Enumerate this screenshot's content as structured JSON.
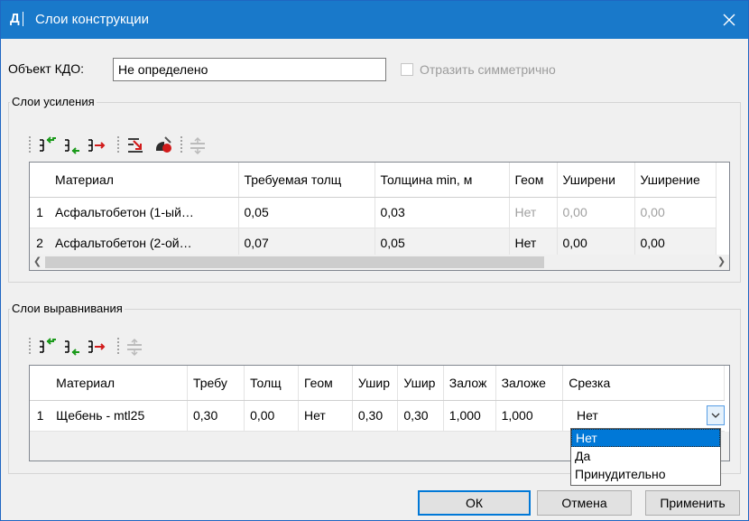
{
  "window": {
    "title": "Слои конструкции",
    "app_icon": "Д"
  },
  "object": {
    "label": "Объект КДО:",
    "value": "Не определено"
  },
  "mirror": {
    "label": "Отразить симметрично",
    "checked": false,
    "enabled": false
  },
  "reinforcement": {
    "title": "Слои усиления",
    "toolbar_icons": [
      "insert-row-before-icon",
      "insert-row-after-icon",
      "delete-row-icon",
      "import-icon",
      "clear-icon",
      "layer-settings-icon"
    ],
    "columns": [
      "Материал",
      "Требуемая толщ",
      "Толщина min, м",
      "Геом",
      "Уширени",
      "Уширение"
    ],
    "rows": [
      {
        "num": "1",
        "cells": [
          "Асфальтобетон (1-ый…",
          "0,05",
          "0,03",
          "Нет",
          "0,00",
          "0,00"
        ]
      },
      {
        "num": "2",
        "cells": [
          "Асфальтобетон (2-ой…",
          "0,07",
          "0,05",
          "Нет",
          "0,00",
          "0,00"
        ]
      }
    ]
  },
  "leveling": {
    "title": "Слои выравнивания",
    "toolbar_icons": [
      "insert-row-before-icon",
      "insert-row-after-icon",
      "delete-row-icon",
      "layer-settings-icon"
    ],
    "columns": [
      "Материал",
      "Требу",
      "Толщ",
      "Геом",
      "Ушир",
      "Ушир",
      "Залож",
      "Заложе",
      "Срезка"
    ],
    "rows": [
      {
        "num": "1",
        "cells": [
          "Щебень - mtl25",
          "0,30",
          "0,00",
          "Нет",
          "0,30",
          "0,30",
          "1,000",
          "1,000",
          "Нет"
        ]
      }
    ],
    "cut_options": [
      "Нет",
      "Да",
      "Принудительно"
    ],
    "cut_selected": "Нет"
  },
  "buttons": {
    "ok": "ОК",
    "cancel": "Отмена",
    "apply": "Применить"
  },
  "colors": {
    "titlebar": "#1979ca",
    "accent": "#0078d7",
    "window_bg": "#f0f0f0"
  }
}
